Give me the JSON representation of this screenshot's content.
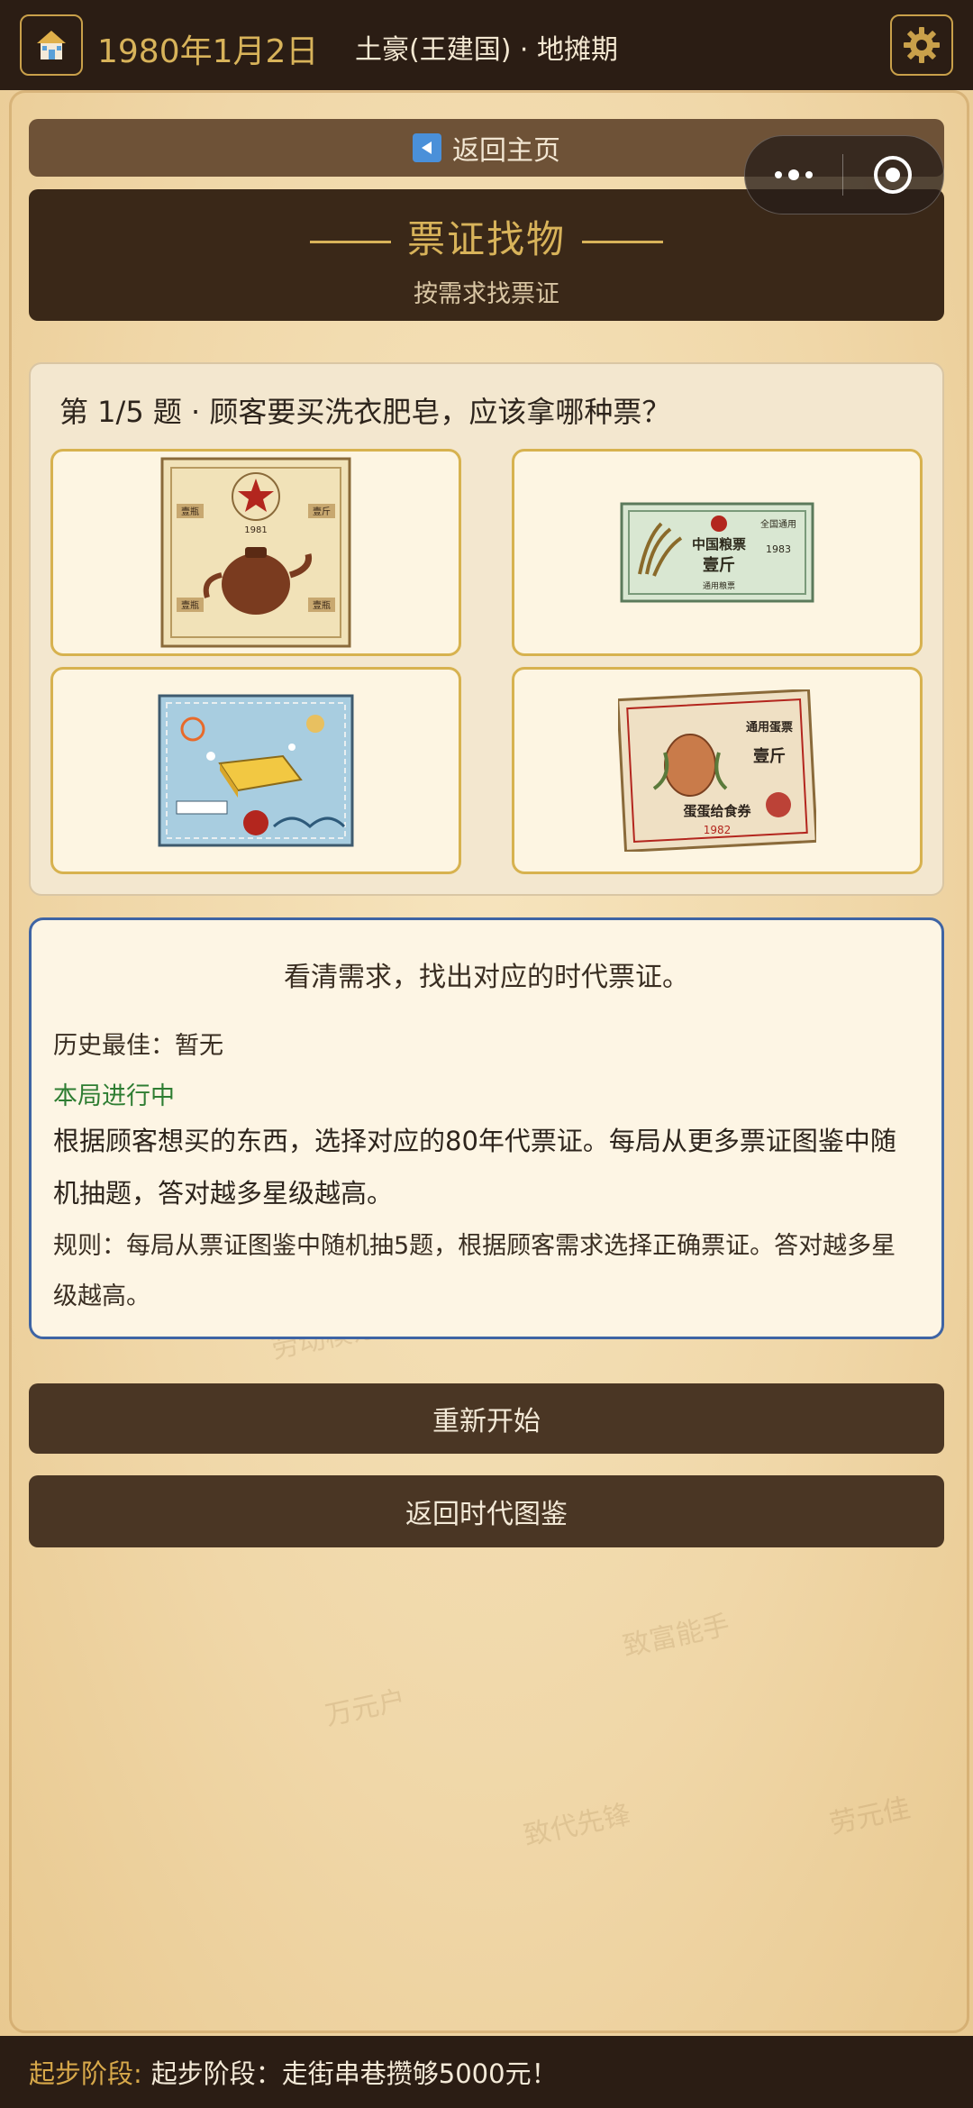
{
  "topbar": {
    "date": "1980年1月2日",
    "player_title": "土豪(王建国) · 地摊期",
    "home_icon": "house-icon",
    "settings_icon": "gear-icon"
  },
  "back": {
    "label": "返回主页",
    "icon": "back-arrow-icon"
  },
  "capsule": {
    "more_icon": "more-dots-icon",
    "close_icon": "target-close-icon"
  },
  "game": {
    "title": "票证找物",
    "subtitle": "按需求找票证"
  },
  "question": {
    "text": "第 1/5 题 · 顾客要买洗衣肥皂，应该拿哪种票？",
    "options": [
      {
        "name": "茶壶票证",
        "ticket_texts": [
          "壹瓶",
          "壹斤",
          "壹瓶",
          "壹瓶",
          "1981"
        ]
      },
      {
        "name": "中国粮票",
        "ticket_texts": [
          "中国粮票",
          "壹斤",
          "全国通用",
          "1983",
          "通用粮票"
        ]
      },
      {
        "name": "肥皂票",
        "ticket_texts": []
      },
      {
        "name": "蛋蛋给食券",
        "ticket_texts": [
          "通用蛋票",
          "壹斤",
          "蛋蛋给食券",
          "1982"
        ]
      }
    ]
  },
  "info": {
    "headline": "看清需求，找出对应的时代票证。",
    "best": "历史最佳：暂无",
    "status": "本局进行中",
    "description": "根据顾客想买的东西，选择对应的80年代票证。每局从更多票证图鉴中随机抽题，答对越多星级越高。",
    "rules": "规则：每局从票证图鉴中随机抽5题，根据顾客需求选择正确票证。答对越多星级越高。"
  },
  "buttons": {
    "restart": "重新开始",
    "back_gallery": "返回时代图鉴"
  },
  "background_words": [
    "万元户",
    "劳动模范",
    "致富能手",
    "致代先锋",
    "劳元佳"
  ],
  "bottombar": {
    "label": "起步阶段:",
    "text": "起步阶段：走街串巷攒够5000元！"
  },
  "colors": {
    "dark_brown": "#2b1d14",
    "gold": "#d8b35a",
    "accent_blue": "#3e64a4",
    "status_green": "#2e7d32"
  }
}
